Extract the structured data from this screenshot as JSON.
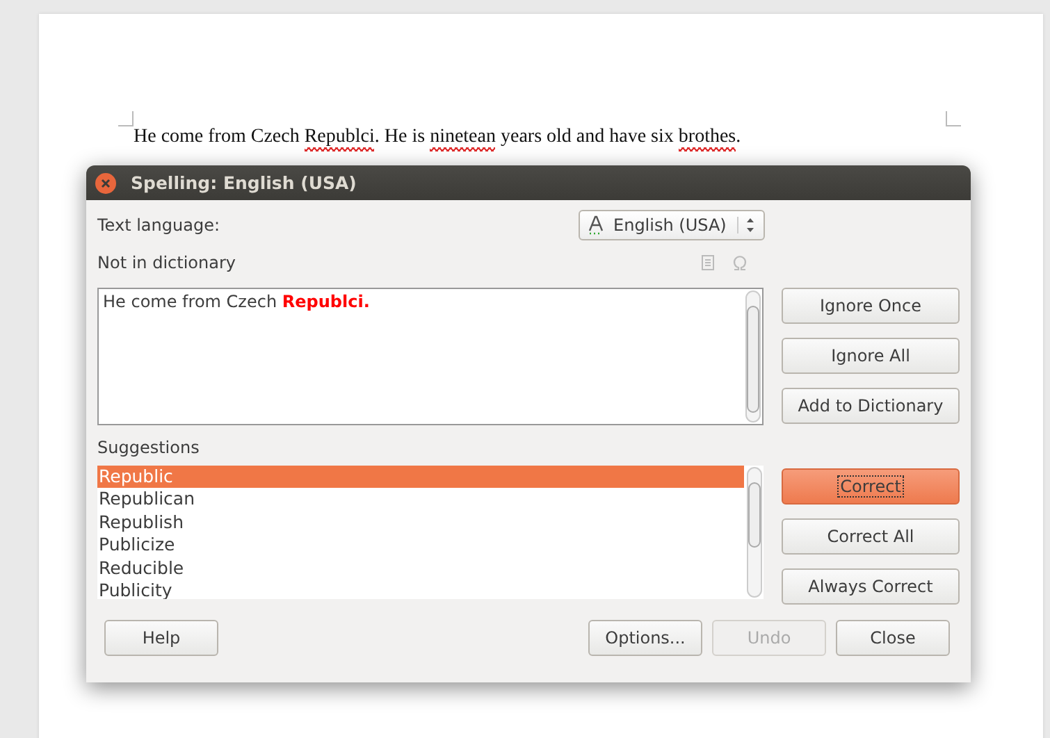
{
  "document": {
    "sentence": [
      {
        "text": "He come from Czech ",
        "misspelled": false
      },
      {
        "text": "Republci",
        "misspelled": true
      },
      {
        "text": ". He is ",
        "misspelled": false
      },
      {
        "text": "ninetean",
        "misspelled": true
      },
      {
        "text": " years old and have six ",
        "misspelled": false
      },
      {
        "text": "brothes",
        "misspelled": true
      },
      {
        "text": ".",
        "misspelled": false
      }
    ]
  },
  "dialog": {
    "title": "Spelling: English (USA)",
    "text_language_label": "Text language:",
    "language": "English (USA)",
    "not_in_dictionary_label": "Not in dictionary",
    "sentence": "He come from Czech **Republci.**",
    "side_buttons": [
      {
        "label": "Ignore Once",
        "default": false
      },
      {
        "label": "Ignore All",
        "default": false
      },
      {
        "label": "Add to Dictionary",
        "default": false
      }
    ],
    "suggestions_label": "Suggestions",
    "suggestions": [
      {
        "text": "Republic",
        "selected": true
      },
      {
        "text": "Republican",
        "selected": false
      },
      {
        "text": "Republish",
        "selected": false
      },
      {
        "text": "Publicize",
        "selected": false
      },
      {
        "text": "Reducible",
        "selected": false
      },
      {
        "text": "Publicity",
        "selected": false
      }
    ],
    "correct_buttons": [
      {
        "label": "Correct",
        "default": true
      },
      {
        "label": "Correct All",
        "default": false
      },
      {
        "label": "Always Correct",
        "default": false
      }
    ],
    "help_button": "Help",
    "footer_buttons": [
      {
        "label": "Options...",
        "disabled": false
      },
      {
        "label": "Undo",
        "disabled": true
      },
      {
        "label": "Close",
        "disabled": false
      }
    ]
  }
}
